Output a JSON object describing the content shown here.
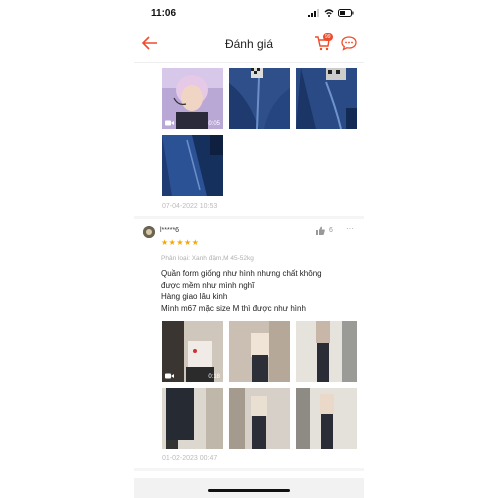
{
  "status_bar": {
    "time": "11:06"
  },
  "header": {
    "title": "Đánh giá",
    "cart_badge": "99",
    "accent_color": "#ee4d2d"
  },
  "review_1": {
    "media": [
      {
        "type": "video",
        "duration": "0:05"
      },
      {
        "type": "image"
      },
      {
        "type": "image"
      },
      {
        "type": "image"
      }
    ],
    "date": "07-04-2022 10:53"
  },
  "review_2": {
    "username": "l*****6",
    "rating": 5,
    "stars": "★★★★★",
    "likes": "6",
    "more": "···",
    "variant": "Phân loại: Xanh đậm,M 45-52kg",
    "comment_lines": [
      "Quần form giống như hình nhưng chất không",
      "được mềm như mình nghĩ",
      "Hàng giao lâu kinh",
      "Mình m67 mặc size M thì được như hình"
    ],
    "media": [
      {
        "type": "video",
        "duration": "0:18"
      },
      {
        "type": "image"
      },
      {
        "type": "image"
      },
      {
        "type": "image"
      },
      {
        "type": "image"
      },
      {
        "type": "image"
      },
      {
        "type": "image"
      },
      {
        "type": "image"
      }
    ],
    "date": "01-02-2023 00:47"
  },
  "icons": [
    "back-arrow-icon",
    "cart-icon",
    "chat-icon",
    "thumbs-up-icon",
    "video-camera-icon",
    "signal-icon",
    "wifi-icon",
    "battery-icon"
  ]
}
